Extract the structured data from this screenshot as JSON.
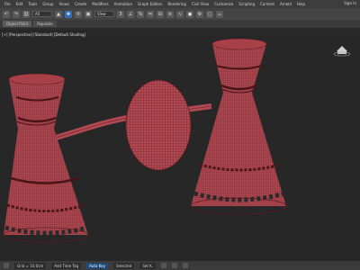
{
  "menu": {
    "items": [
      "File",
      "Edit",
      "Tools",
      "Group",
      "Views",
      "Create",
      "Modifiers",
      "Animation",
      "Graph Editors",
      "Rendering",
      "Civil View",
      "Customize",
      "Scripting",
      "Content",
      "Arnold",
      "Help"
    ],
    "sign_in": "Sign In"
  },
  "toolbar": {
    "selection_filter": "All",
    "view_mode": "View"
  },
  "ribbon": {
    "tabs": [
      "Object Paint",
      "Populate"
    ]
  },
  "viewport": {
    "label": "[+] [Perspective] [Standard] [Default Shading]"
  },
  "status": {
    "grid": "Grid = 10.0cm",
    "time_tag": "Add Time Tag",
    "auto_key": "Auto Key",
    "selected": "Selected",
    "set_key": "Set K."
  },
  "colors": {
    "mesh": "#b14a52",
    "wire": "#5a1c22",
    "accent": "#2f6fb6"
  }
}
